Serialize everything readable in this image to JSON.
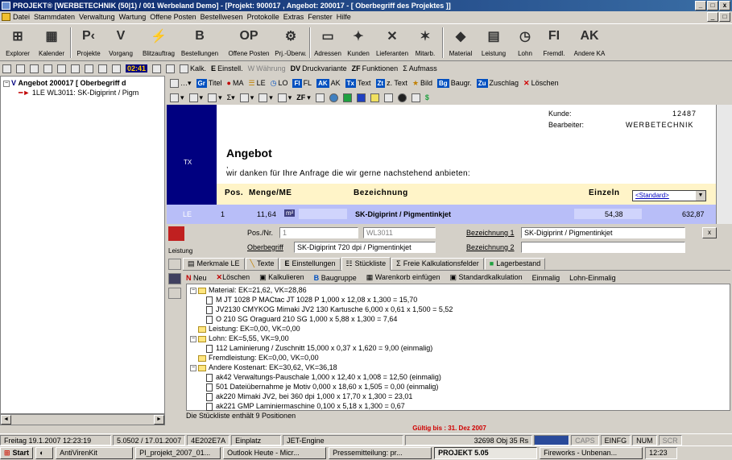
{
  "window": {
    "title": "PROJEKT® [WERBETECHNIK (50|1) / 001 Werbeland Demo] - [Projekt: 900017 , Angebot: 200017 - [ Oberbegriff des Projektes ]]"
  },
  "menu": [
    "Datei",
    "Stammdaten",
    "Verwaltung",
    "Wartung",
    "Offene Posten",
    "Bestellwesen",
    "Protokolle",
    "Extras",
    "Fenster",
    "Hilfe"
  ],
  "toolbar": {
    "explorer": "Explorer",
    "kalender": "Kalender",
    "projekte": "Projekte",
    "vorgang": "Vorgang",
    "blitzauftrag": "Blitzauftrag",
    "bestellungen": "Bestellungen",
    "offene_posten": "Offene Posten",
    "prj_uberw": "Prj.-Überw.",
    "adressen": "Adressen",
    "kunden": "Kunden",
    "lieferanten": "Lieferanten",
    "mitarb": "Mitarb.",
    "material": "Material",
    "leistung": "Leistung",
    "lohn": "Lohn",
    "fremdl": "Fremdl.",
    "andere_ka": "Andere KA",
    "b_glyph": "B",
    "op_glyph": "OP",
    "fi_glyph": "FI",
    "ak_glyph": "AK"
  },
  "smalltools": {
    "time": "02:41",
    "kalk": "Kalk.",
    "einstell": "Einstell.",
    "wahrung": "Währung",
    "druckvariante": "Druckvariante",
    "funktionen": "Funktionen",
    "aufmass": "Aufmass",
    "dv": "DV",
    "zf": "ZF",
    "sigma": "Σ",
    "e": "E"
  },
  "tree": {
    "root": "Angebot 200017 [ Oberbegriff d",
    "child": "1LE WL3011: SK-Digiprint / Pigm"
  },
  "doctools": {
    "titel": "Titel",
    "ma": "MA",
    "le": "LE",
    "lo": "LO",
    "fl": "FL",
    "ak": "AK",
    "text": "Text",
    "ztext": "z. Text",
    "bild": "Bild",
    "baugr": "Baugr.",
    "zuschlag": "Zuschlag",
    "loeschen": "Löschen",
    "gr": "Gr",
    "fi": "FI",
    "tx": "Tx",
    "zt": "Zt",
    "bg": "Bg",
    "zu": "Zu"
  },
  "doc": {
    "kunde_label": "Kunde:",
    "kunde_value": "12487",
    "bearbeiter_label": "Bearbeiter:",
    "bearbeiter_value": "WERBETECHNIK",
    "heading": "Angebot",
    "comma": ",",
    "intro": "wir danken für Ihre Anfrage die wir gerne nachstehend anbieten:",
    "tx_tag": "TX",
    "col_pos": "Pos.",
    "col_menge": "Menge/ME",
    "col_bez": "Bezeichnung",
    "col_einzeln": "Einzeln",
    "standard": "<Standard>",
    "row": {
      "tag": "LE",
      "pos": "1",
      "menge": "11,64",
      "me": "m²",
      "bez": "SK-Digiprint / Pigmentinkjet",
      "einzeln": "54,38",
      "gesamt": "632,87"
    }
  },
  "leistung": {
    "label": "Leistung",
    "posnr_label": "Pos./Nr.",
    "posnr_value": "1",
    "wl_value": "WL3011",
    "bez1_label": "Bezeichnung 1",
    "bez1_value": "SK-Digiprint / Pigmentinkjet",
    "ober_label": "Oberbegriff",
    "ober_value": "SK-Digiprint 720 dpi / Pigmentinkjet",
    "bez2_label": "Bezeichnung 2",
    "bez2_value": "",
    "close": "x"
  },
  "tabs": [
    "Merkmale LE",
    "Texte",
    "Einstellungen",
    "Stückliste",
    "Freie Kalkulationsfelder",
    "Lagerbestand"
  ],
  "actions": {
    "neu": "Neu",
    "loeschen": "Löschen",
    "kalkulieren": "Kalkulieren",
    "baugruppe": "Baugruppe",
    "warenkorb": "Warenkorb einfügen",
    "standard": "Standardkalkulation",
    "einmalig": "Einmalig",
    "lohn_einmalig": "Lohn-Einmalig"
  },
  "stueckliste": [
    {
      "type": "group",
      "text": "Material:  EK=21,62, VK=28,86"
    },
    {
      "type": "item",
      "text": "M JT 1028 P MACtac JT 1028 P 1,000 x 12,08 x 1,300 = 15,70"
    },
    {
      "type": "item",
      "text": "JV2130 CMYKOG Mimaki JV2 130  Kartusche 6,000 x 0,61 x 1,500 = 5,52"
    },
    {
      "type": "item",
      "text": "O 210 SG Oraguard 210 SG 1,000 x 5,88 x 1,300 = 7,64"
    },
    {
      "type": "group",
      "text": "Leistung:  EK=0,00, VK=0,00"
    },
    {
      "type": "group",
      "text": "Lohn:  EK=5,55, VK=9,00"
    },
    {
      "type": "item",
      "text": "112 Laminierung / Zuschnitt 15,000 x 0,37 x 1,620 = 9,00 (einmalig)"
    },
    {
      "type": "group",
      "text": "Fremdleistung:  EK=0,00, VK=0,00"
    },
    {
      "type": "group",
      "text": "Andere Kostenart:  EK=30,62, VK=36,18"
    },
    {
      "type": "item",
      "text": "ak42 Verwaltungs-Pauschale 1,000 x 12,40 x 1,008 = 12,50 (einmalig)"
    },
    {
      "type": "item",
      "text": "501 Dateiübernahme je Motiv 0,000 x 18,60 x 1,505 = 0,00 (einmalig)"
    },
    {
      "type": "item",
      "text": "ak220 Mimaki JV2, bei 360 dpi 1,000 x 17,70 x 1,300 = 23,01"
    },
    {
      "type": "item",
      "text": "ak221 GMP Laminiermaschine 0,100 x 5,18 x 1,300 = 0,67"
    }
  ],
  "stueck_status": "Die Stückliste enthält 9 Positionen",
  "gueltig": "Gültig bis : 31. Dez 2007",
  "status": {
    "datetime": "Freitag 19.1.2007 12:23:19",
    "version": "5.0502 / 17.01.2007",
    "code": "4E202E7A",
    "mode": "Einplatz",
    "engine": "JET-Engine",
    "obj": "32698 Obj 35 Rs",
    "caps": "CAPS",
    "einfg": "EINFG",
    "num": "NUM",
    "scr": "SCR"
  },
  "taskbar": {
    "start": "Start",
    "antivir": "AntiVirenKit",
    "pi": "PI_projekt_2007_01...",
    "outlook": "Outlook Heute - Micr...",
    "presse": "Pressemitteilung: pr...",
    "projekt": "PROJEKT 5.05",
    "fireworks": "Fireworks - Unbenan...",
    "time": "12:23"
  }
}
